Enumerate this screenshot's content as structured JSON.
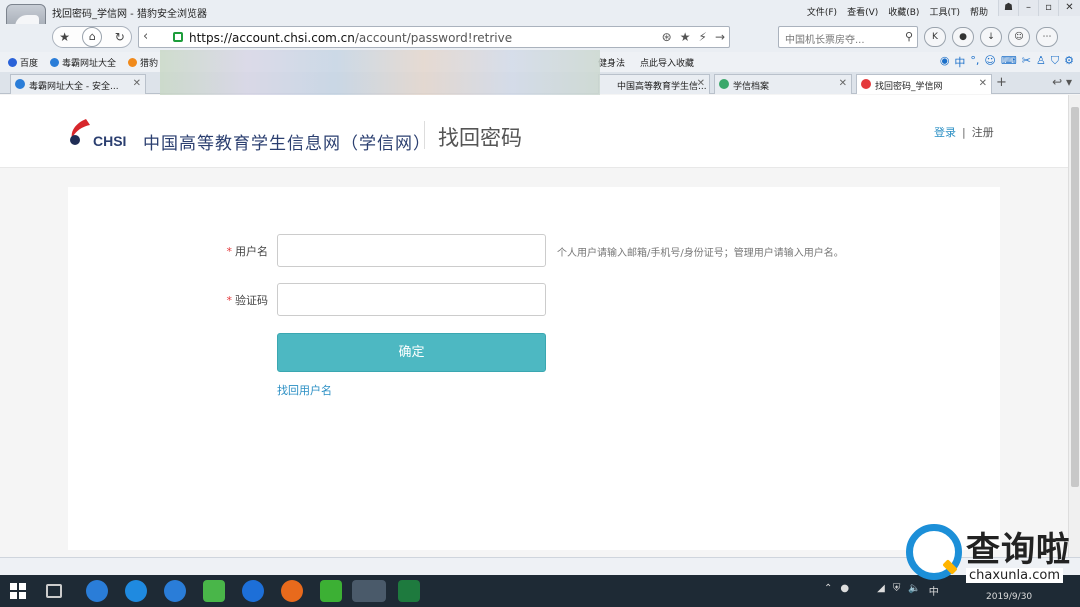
{
  "browser": {
    "window_title": "找回密码_学信网 - 猎豹安全浏览器",
    "menu": [
      "文件(F)",
      "查看(V)",
      "收藏(B)",
      "工具(T)",
      "帮助"
    ],
    "url_host": "https://account.chsi.com.cn",
    "url_path": "/account/password!retrive",
    "search_text": "中国机长票房夺...",
    "bookmarks": [
      "百度",
      "毒霸网址大全",
      "猎豹",
      "健身法",
      "点此导入收藏"
    ],
    "tabs": [
      {
        "label": "毒霸网址大全 - 安全...",
        "active": false,
        "color": "#2a7dd8"
      },
      {
        "label": "中国高等教育学生信...",
        "active": false,
        "color": "#e4393c"
      },
      {
        "label": "学信档案",
        "active": false,
        "color": "#3aa86b"
      },
      {
        "label": "找回密码_学信网",
        "active": true,
        "color": "#e4393c"
      }
    ],
    "new_tab_glyph": "+"
  },
  "header": {
    "logo_text": "CHSI",
    "site_name": "中国高等教育学生信息网（学信网）",
    "page_title": "找回密码",
    "login": "登录",
    "separator": "|",
    "register": "注册"
  },
  "form": {
    "required_mark": "*",
    "username_label": "用户名",
    "username_value": "",
    "username_hint": "个人用户请输入邮箱/手机号/身份证号；管理用户请输入用户名。",
    "captcha_label": "验证码",
    "captcha_value": "",
    "submit_label": "确定",
    "retrieve_username_link": "找回用户名"
  },
  "taskbar": {
    "tray_ime": "中",
    "date": "2019/9/30"
  },
  "watermark": {
    "cn": "查询啦",
    "en": "chaxunla.com"
  }
}
